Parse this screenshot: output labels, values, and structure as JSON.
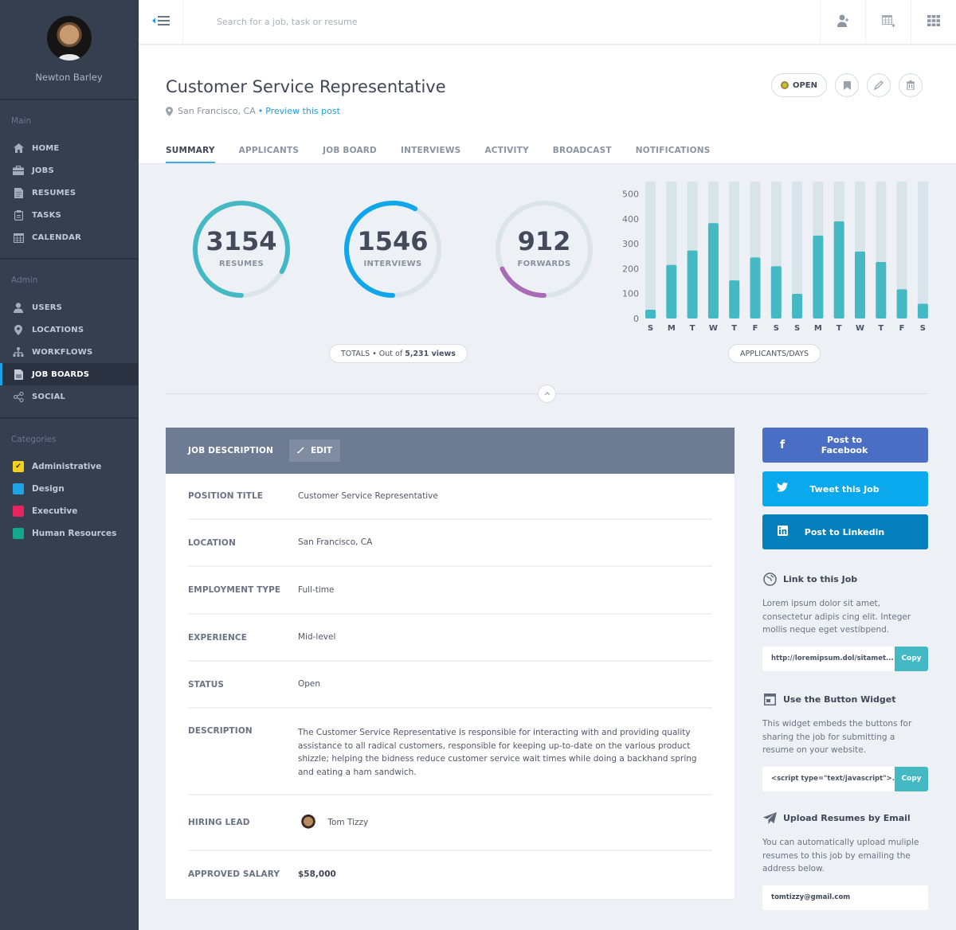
{
  "sidebar": {
    "user_name": "Newton Barley",
    "main_heading": "Main",
    "main_items": [
      {
        "label": "HOME",
        "icon": "home-icon"
      },
      {
        "label": "JOBS",
        "icon": "briefcase-icon"
      },
      {
        "label": "RESUMES",
        "icon": "document-icon"
      },
      {
        "label": "TASKS",
        "icon": "clipboard-icon"
      },
      {
        "label": "CALENDAR",
        "icon": "calendar-icon"
      }
    ],
    "admin_heading": "Admin",
    "admin_items": [
      {
        "label": "USERS",
        "icon": "user-icon"
      },
      {
        "label": "LOCATIONS",
        "icon": "map-pin-icon"
      },
      {
        "label": "WORKFLOWS",
        "icon": "sitemap-icon"
      },
      {
        "label": "JOB BOARDS",
        "icon": "board-icon",
        "active": true
      },
      {
        "label": "SOCIAL",
        "icon": "share-icon"
      }
    ],
    "categories_heading": "Categories",
    "categories": [
      {
        "label": "Administrative",
        "color": "#f5d020",
        "checked": true
      },
      {
        "label": "Design",
        "color": "#1ea3e6"
      },
      {
        "label": "Executive",
        "color": "#e8245f"
      },
      {
        "label": "Human Resources",
        "color": "#14a98c"
      }
    ]
  },
  "topbar": {
    "search_placeholder": "Search for a job, task or resume"
  },
  "header": {
    "title": "Customer Service Representative",
    "location": "San Francisco, CA",
    "separator": "•",
    "preview_link": "Preview this post",
    "status_label": "OPEN",
    "tabs": [
      "SUMMARY",
      "APPLICANTS",
      "JOB BOARD",
      "INTERVIEWS",
      "ACTIVITY",
      "BROADCAST",
      "NOTIFICATIONS"
    ],
    "active_tab": "SUMMARY"
  },
  "summary": {
    "rings": [
      {
        "value": "3154",
        "label": "RESUMES",
        "progress": 0.83,
        "color": "#45b9c3"
      },
      {
        "value": "1546",
        "label": "INTERVIEWS",
        "progress": 0.58,
        "color": "#11a6e9"
      },
      {
        "value": "912",
        "label": "FORWARDS",
        "progress": 0.18,
        "color": "#a86bb6"
      }
    ],
    "totals_prefix": "TOTALS • Out of",
    "totals_views": "5,231 views",
    "chart_label": "APPLICANTS/DAYS"
  },
  "chart_data": {
    "type": "bar",
    "title": "",
    "xlabel": "",
    "ylabel": "",
    "categories": [
      "S",
      "M",
      "T",
      "W",
      "T",
      "F",
      "S",
      "S",
      "M",
      "T",
      "W",
      "T",
      "F",
      "S"
    ],
    "values": [
      35,
      215,
      273,
      383,
      153,
      245,
      210,
      99,
      333,
      390,
      269,
      227,
      117,
      59
    ],
    "ylim": [
      0,
      550
    ],
    "yticks": [
      0,
      100,
      200,
      300,
      400,
      500
    ],
    "bar_color": "#45b9c3",
    "track_color": "#d9e3ea",
    "grid": false
  },
  "job_description": {
    "title": "JOB DESCRIPTION",
    "edit_label": "EDIT",
    "rows": [
      {
        "label": "POSITION TITLE",
        "value": "Customer Service Representative"
      },
      {
        "label": "LOCATION",
        "value": "San Francisco, CA"
      },
      {
        "label": "EMPLOYMENT TYPE",
        "value": "Full-time"
      },
      {
        "label": "EXPERIENCE",
        "value": "Mid-level"
      },
      {
        "label": "STATUS",
        "value": "Open"
      },
      {
        "label": "DESCRIPTION",
        "value": "The Customer Service Representative is responsible for interacting with and providing quality assistance to all radical customers, responsible for keeping up-to-date on the various product shizzle; helping the bidness reduce customer service wait times while doing a backhand spring and eating a ham sandwich."
      },
      {
        "label": "HIRING LEAD",
        "value": "Tom Tizzy"
      },
      {
        "label": "APPROVED SALARY",
        "value": "$58,000"
      }
    ]
  },
  "share": {
    "facebook": {
      "label": "Post to Facebook",
      "color": "#4a6ec4"
    },
    "twitter": {
      "label": "Tweet this Job",
      "color": "#0aa9ee"
    },
    "linkedin": {
      "label": "Post to Linkedin",
      "color": "#0580bc"
    }
  },
  "widgets": {
    "link": {
      "title": "Link to this Job",
      "text": "Lorem ipsum dolor sit amet, consectetur adipis cing elit. Integer mollis neque eget vestibpend.",
      "field_value": "http://loremipsum.dol/sitamet...",
      "copy_label": "Copy"
    },
    "button_widget": {
      "title": "Use the Button Widget",
      "text": "This widget embeds the buttons for sharing the job for submitting a resume on your website.",
      "field_value": "<script type=\"text/javascript\">...",
      "copy_label": "Copy"
    },
    "email": {
      "title": "Upload Resumes by Email",
      "text": "You can automatically upload muliple resumes to this job by emailing the address below.",
      "email": "tomtizzy@gmail.com"
    }
  }
}
